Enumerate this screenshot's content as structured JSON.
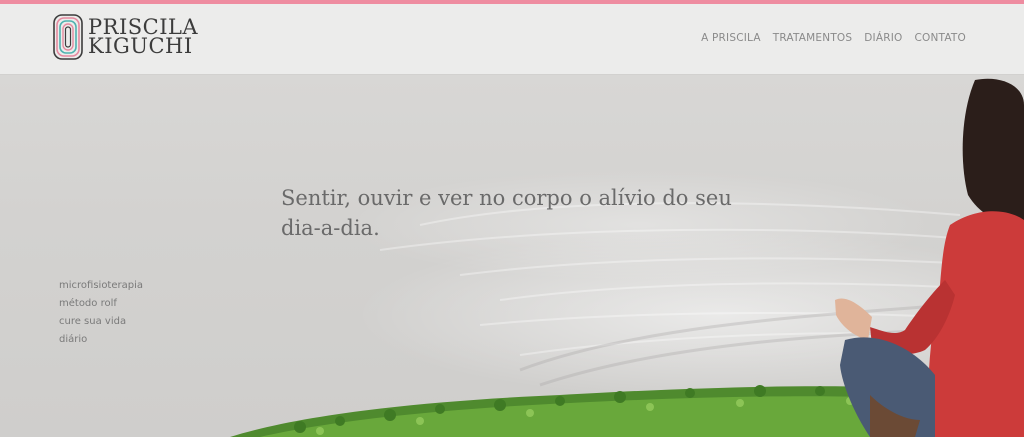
{
  "header": {
    "logo": {
      "line1": "PRISCILA",
      "line2": "KIGUCHI"
    },
    "nav": [
      {
        "label": "A PRISCILA"
      },
      {
        "label": "TRATAMENTOS"
      },
      {
        "label": "DIÁRIO"
      },
      {
        "label": "CONTATO"
      }
    ]
  },
  "hero": {
    "tagline": "Sentir, ouvir e ver no corpo o alívio do seu dia-a-dia.",
    "side_menu": [
      {
        "label": "microfisioterapia"
      },
      {
        "label": "método rolf"
      },
      {
        "label": "cure sua vida"
      },
      {
        "label": "diário"
      }
    ]
  },
  "colors": {
    "accent_stripe": "#ee8ca0",
    "header_bg": "#ececeb",
    "text": "#6a6a6a"
  }
}
